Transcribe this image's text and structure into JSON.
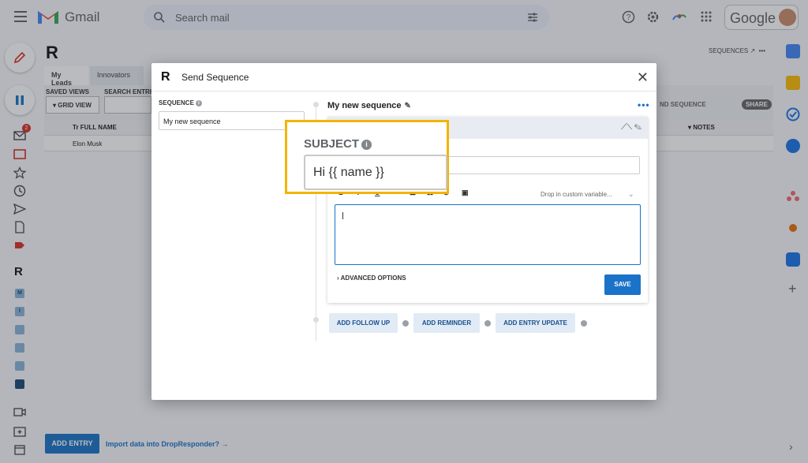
{
  "gmail": {
    "app_name": "Gmail",
    "search_placeholder": "Search mail",
    "google_label": "Google",
    "badge_count": "2"
  },
  "background": {
    "tabs": [
      "My Leads",
      "Innovators"
    ],
    "saved_views_label": "SAVED VIEWS",
    "search_entries_label": "SEARCH ENTRI",
    "grid_view_label": "GRID VIEW",
    "full_name_header": "FULL NAME",
    "notes_header": "NOTES",
    "row_name": "Elon Musk",
    "send_sequence_label": "ND SEQUENCE",
    "share_label": "SHARE",
    "sequences_link": "SEQUENCES",
    "add_entry_label": "ADD ENTRY",
    "import_link": "Import data into DropResponder? →",
    "rail_apps": [
      "M",
      "I"
    ]
  },
  "modal": {
    "title": "Send Sequence",
    "sequence_label": "SEQUENCE",
    "sequence_value": "My new sequence",
    "sequence_name": "My new sequence",
    "dropin_label": "Drop in custom variable...",
    "advanced_options": "ADVANCED OPTIONS",
    "save_label": "SAVE",
    "add_follow_up": "ADD FOLLOW UP",
    "add_reminder": "ADD REMINDER",
    "add_entry_update": "ADD ENTRY UPDATE"
  },
  "callout": {
    "label": "SUBJECT",
    "value": "Hi {{ name }}"
  },
  "colors": {
    "accent": "#1a73c8",
    "callout_border": "#f4b400",
    "overlay": "rgba(40,44,52,0.32)"
  }
}
